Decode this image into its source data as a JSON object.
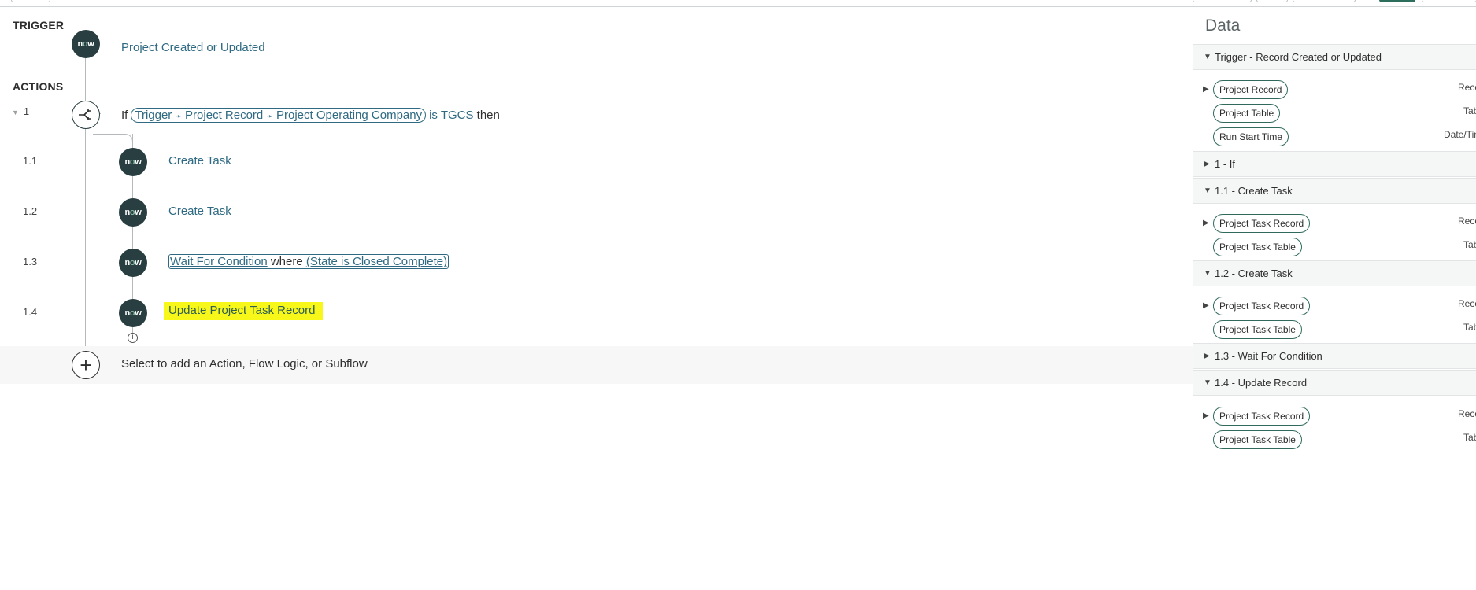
{
  "canvas": {
    "trigger_heading": "TRIGGER",
    "actions_heading": "ACTIONS",
    "trigger_label": "Project Created or Updated",
    "steps": [
      {
        "num": "1",
        "if_word": "If",
        "pill_parts": [
          "Trigger",
          "Project Record",
          "Project Operating Company"
        ],
        "cond_tail": "is TGCS",
        "then_word": "then"
      },
      {
        "num": "1.1",
        "label": "Create Task"
      },
      {
        "num": "1.2",
        "label": "Create Task"
      },
      {
        "num": "1.3",
        "label_a": "Wait For Condition",
        "label_b": "where",
        "label_c": "(State is Closed Complete)"
      },
      {
        "num": "1.4",
        "label": "Update Project Task Record"
      }
    ],
    "add_prompt": "Select to add an Action, Flow Logic, or Subflow",
    "node_logo": "now"
  },
  "data_panel": {
    "title": "Data",
    "groups": [
      {
        "title": "Trigger - Record Created or Updated",
        "expanded": true,
        "items": [
          {
            "label": "Project Record",
            "type": "Reco",
            "expandable": true
          },
          {
            "label": "Project Table",
            "type": "Tab",
            "expandable": false
          },
          {
            "label": "Run Start Time",
            "type": "Date/Tim",
            "expandable": false
          }
        ]
      },
      {
        "title": "1 - If",
        "expanded": false,
        "items": []
      },
      {
        "title": "1.1 - Create Task",
        "expanded": true,
        "items": [
          {
            "label": "Project Task Record",
            "type": "Reco",
            "expandable": true
          },
          {
            "label": "Project Task Table",
            "type": "Tab",
            "expandable": false
          }
        ]
      },
      {
        "title": "1.2 - Create Task",
        "expanded": true,
        "items": [
          {
            "label": "Project Task Record",
            "type": "Reco",
            "expandable": true
          },
          {
            "label": "Project Task Table",
            "type": "Tab",
            "expandable": false
          }
        ]
      },
      {
        "title": "1.3 - Wait For Condition",
        "expanded": false,
        "items": []
      },
      {
        "title": "1.4 - Update Record",
        "expanded": true,
        "items": [
          {
            "label": "Project Task Record",
            "type": "Reco",
            "expandable": true
          },
          {
            "label": "Project Task Table",
            "type": "Tab",
            "expandable": false
          }
        ]
      }
    ]
  },
  "colors": {
    "accent": "#2f6a82",
    "node": "#293e40",
    "highlight": "#f7f71a"
  }
}
